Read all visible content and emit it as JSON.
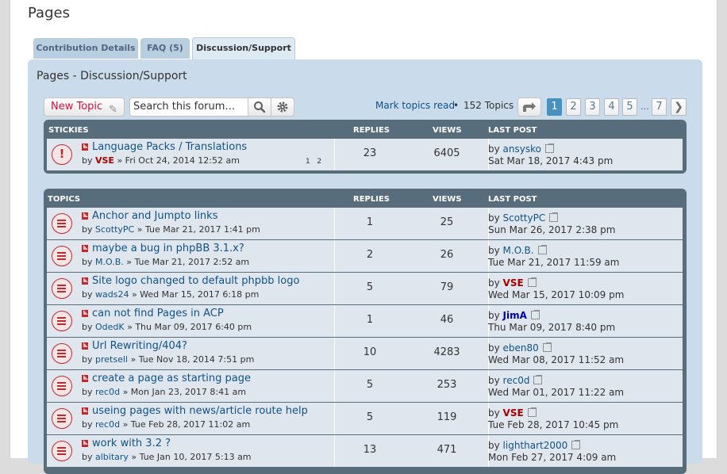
{
  "page_title": "Pages",
  "tabs": [
    {
      "label": "Contribution Details"
    },
    {
      "label": "FAQ (5)"
    },
    {
      "label": "Discussion/Support"
    }
  ],
  "panel_title": "Pages - Discussion/Support",
  "toolbar": {
    "new_topic_label": "New Topic",
    "search_placeholder": "Search this forum…",
    "search_icon": "search-icon",
    "advanced_search_icon": "gear-icon",
    "mark_read_label": "Mark topics read",
    "separator": "•",
    "topics_count": "152 Topics",
    "jump_icon": "share-arrow-icon"
  },
  "pagination": {
    "pages": [
      "1",
      "2",
      "3",
      "4",
      "5"
    ],
    "current": "1",
    "ellipsis": "…",
    "last": "7",
    "next_icon": "chevron-right-icon"
  },
  "columns": {
    "stickies": "STICKIES",
    "topics": "TOPICS",
    "replies": "REPLIES",
    "views": "VIEWS",
    "last_post": "LAST POST"
  },
  "stickies": [
    {
      "title": "Language Packs / Translations",
      "by": "by",
      "author": "VSE",
      "author_style": "red",
      "date": "» Fri Oct 24, 2014 12:52 am",
      "mini_pages": [
        "1",
        "2"
      ],
      "replies": "23",
      "views": "6405",
      "last_by": "by",
      "last_author": "ansysko",
      "last_author_style": "",
      "last_date": "Sat Mar 18, 2017 4:43 pm"
    }
  ],
  "topics": [
    {
      "title": "Anchor and Jumpto links",
      "by": "by",
      "author": "ScottyPC",
      "author_style": "",
      "date": "» Tue Mar 21, 2017 1:41 pm",
      "replies": "1",
      "views": "25",
      "last_by": "by",
      "last_author": "ScottyPC",
      "last_author_style": "",
      "last_date": "Sun Mar 26, 2017 2:38 pm"
    },
    {
      "title": "maybe a bug in phpBB 3.1.x?",
      "by": "by",
      "author": "M.O.B.",
      "author_style": "",
      "date": "» Tue Mar 21, 2017 2:52 am",
      "replies": "2",
      "views": "26",
      "last_by": "by",
      "last_author": "M.O.B.",
      "last_author_style": "",
      "last_date": "Tue Mar 21, 2017 11:59 am"
    },
    {
      "title": "Site logo changed to default phpbb logo",
      "by": "by",
      "author": "wads24",
      "author_style": "",
      "date": "» Wed Mar 15, 2017 6:18 pm",
      "replies": "5",
      "views": "79",
      "last_by": "by",
      "last_author": "VSE",
      "last_author_style": "red",
      "last_date": "Wed Mar 15, 2017 10:09 pm"
    },
    {
      "title": "can not find Pages in ACP",
      "by": "by",
      "author": "OdedK",
      "author_style": "",
      "date": "» Thu Mar 09, 2017 6:40 pm",
      "replies": "1",
      "views": "46",
      "last_by": "by",
      "last_author": "JimA",
      "last_author_style": "blue",
      "last_date": "Thu Mar 09, 2017 8:40 pm"
    },
    {
      "title": "Url Rewriting/404?",
      "by": "by",
      "author": "pretsell",
      "author_style": "",
      "date": "» Tue Nov 18, 2014 7:51 pm",
      "replies": "10",
      "views": "4283",
      "last_by": "by",
      "last_author": "eben80",
      "last_author_style": "",
      "last_date": "Wed Mar 08, 2017 11:52 am"
    },
    {
      "title": "create a page as starting page",
      "by": "by",
      "author": "rec0d",
      "author_style": "",
      "date": "» Mon Jan 23, 2017 8:41 am",
      "replies": "5",
      "views": "253",
      "last_by": "by",
      "last_author": "rec0d",
      "last_author_style": "",
      "last_date": "Wed Mar 01, 2017 11:22 am"
    },
    {
      "title": "useing pages with news/article route help",
      "by": "by",
      "author": "rec0d",
      "author_style": "",
      "date": "» Tue Feb 28, 2017 11:02 am",
      "replies": "5",
      "views": "119",
      "last_by": "by",
      "last_author": "VSE",
      "last_author_style": "red",
      "last_date": "Tue Feb 28, 2017 10:45 pm"
    },
    {
      "title": "work with 3.2 ?",
      "by": "by",
      "author": "albitary",
      "author_style": "",
      "date": "» Tue Jan 10, 2017 5:13 am",
      "replies": "13",
      "views": "471",
      "last_by": "by",
      "last_author": "lighthart2000",
      "last_author_style": "",
      "last_date": "Mon Feb 27, 2017 4:09 am"
    }
  ]
}
